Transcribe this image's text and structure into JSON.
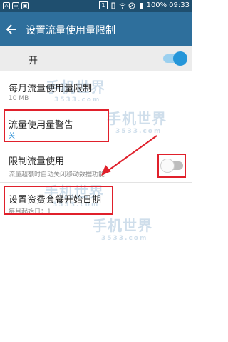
{
  "status_bar": {
    "battery": "100%",
    "time": "09:33",
    "notif_icons": [
      "A",
      "▭",
      "▣"
    ],
    "sim_label": "1"
  },
  "app_bar": {
    "title": "设置流量使用量限制"
  },
  "master_switch": {
    "label": "开",
    "state": "on"
  },
  "settings": [
    {
      "title": "每月流量使用量限制",
      "subtitle": "10 MB"
    },
    {
      "title": "流量使用量警告",
      "subtitle": "关"
    },
    {
      "title": "限制流量使用",
      "subtitle": "流量超额时自动关闭移动数据功能",
      "toggle": "off"
    },
    {
      "title": "设置资费套餐开始日期",
      "subtitle": "每月起始日：1"
    }
  ],
  "watermarks": {
    "brand": "手机世界",
    "site": "3533.com"
  },
  "colors": {
    "status_bar": "#1f4f6f",
    "app_bar": "#2e6f9c",
    "accent": "#2596d9",
    "highlight": "#e0202b"
  }
}
